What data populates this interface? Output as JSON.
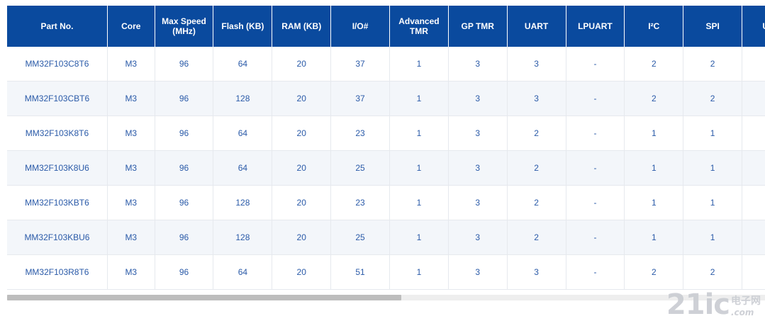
{
  "table": {
    "columns": [
      "Part No.",
      "Core",
      "Max Speed (MHz)",
      "Flash (KB)",
      "RAM (KB)",
      "I/O#",
      "Advanced TMR",
      "GP TMR",
      "UART",
      "LPUART",
      "I²C",
      "SPI",
      "USB"
    ],
    "rows": [
      [
        "MM32F103C8T6",
        "M3",
        "96",
        "64",
        "20",
        "37",
        "1",
        "3",
        "3",
        "-",
        "2",
        "2",
        ""
      ],
      [
        "MM32F103CBT6",
        "M3",
        "96",
        "128",
        "20",
        "37",
        "1",
        "3",
        "3",
        "-",
        "2",
        "2",
        ""
      ],
      [
        "MM32F103K8T6",
        "M3",
        "96",
        "64",
        "20",
        "23",
        "1",
        "3",
        "2",
        "-",
        "1",
        "1",
        ""
      ],
      [
        "MM32F103K8U6",
        "M3",
        "96",
        "64",
        "20",
        "25",
        "1",
        "3",
        "2",
        "-",
        "1",
        "1",
        ""
      ],
      [
        "MM32F103KBT6",
        "M3",
        "96",
        "128",
        "20",
        "23",
        "1",
        "3",
        "2",
        "-",
        "1",
        "1",
        ""
      ],
      [
        "MM32F103KBU6",
        "M3",
        "96",
        "128",
        "20",
        "25",
        "1",
        "3",
        "2",
        "-",
        "1",
        "1",
        ""
      ],
      [
        "MM32F103R8T6",
        "M3",
        "96",
        "64",
        "20",
        "51",
        "1",
        "3",
        "3",
        "-",
        "2",
        "2",
        ""
      ]
    ]
  },
  "scroll": {
    "horizontal_position_fraction": 0.0,
    "thumb_fraction": 0.52
  },
  "watermark": {
    "main": "21ic",
    "cn": "电子网",
    "latin": ".com"
  },
  "colors": {
    "header_bg": "#0a4a9e",
    "header_text": "#ffffff",
    "cell_text": "#2a5aa8",
    "row_alt": "#f3f6fa"
  }
}
